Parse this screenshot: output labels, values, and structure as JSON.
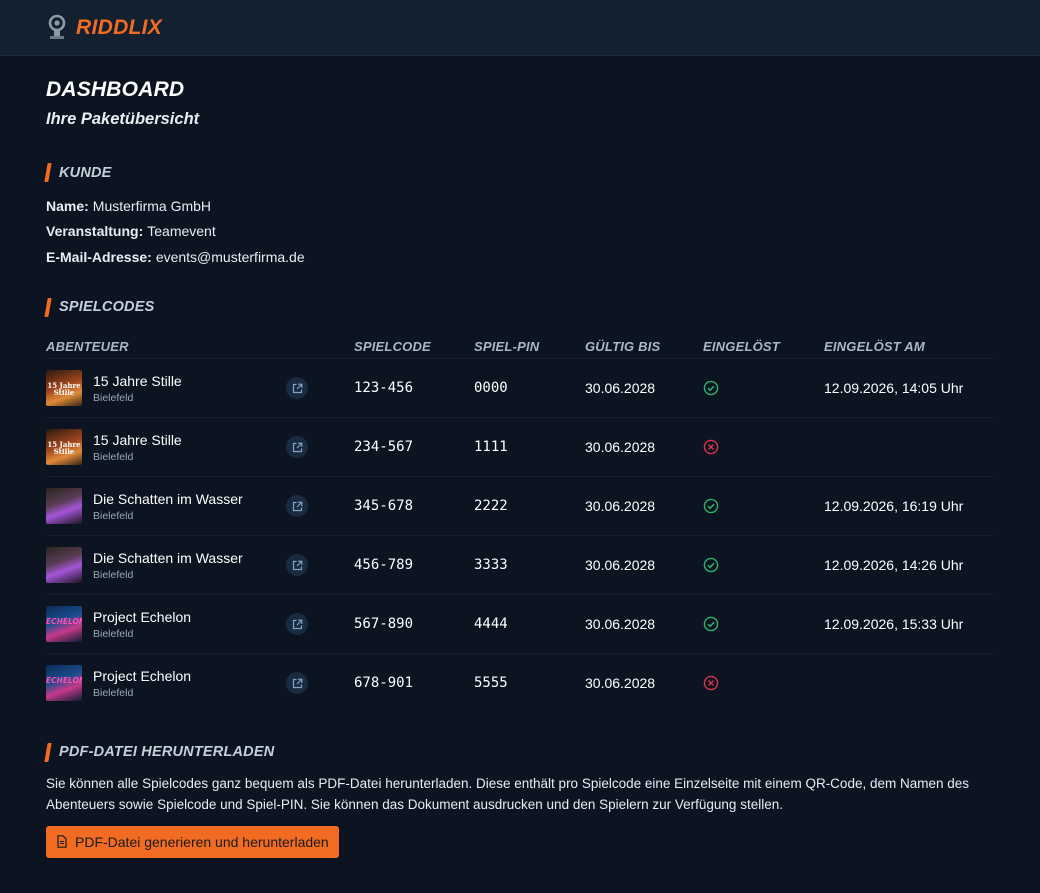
{
  "app": {
    "brand": "RIDDLIX"
  },
  "page": {
    "title": "DASHBOARD",
    "subtitle": "Ihre Paketübersicht"
  },
  "customer": {
    "heading": "KUNDE",
    "name_label": "Name:",
    "name": "Musterfirma GmbH",
    "event_label": "Veranstaltung:",
    "event": "Teamevent",
    "email_label": "E-Mail-Adresse:",
    "email": "events@musterfirma.de"
  },
  "codes": {
    "heading": "SPIELCODES",
    "columns": [
      "ABENTEUER",
      "SPIELCODE",
      "SPIEL-PIN",
      "GÜLTIG BIS",
      "EINGELÖST",
      "EINGELÖST AM"
    ],
    "rows": [
      {
        "title": "15 Jahre Stille",
        "location": "Bielefeld",
        "thumb": "15 Jahre Stille",
        "code": "123-456",
        "pin": "0000",
        "valid": "30.06.2028",
        "redeemed": true,
        "redeemed_at": "12.09.2026, 14:05 Uhr"
      },
      {
        "title": "15 Jahre Stille",
        "location": "Bielefeld",
        "thumb": "15 Jahre Stille",
        "code": "234-567",
        "pin": "1111",
        "valid": "30.06.2028",
        "redeemed": false,
        "redeemed_at": ""
      },
      {
        "title": "Die Schatten im Wasser",
        "location": "Bielefeld",
        "thumb": "",
        "code": "345-678",
        "pin": "2222",
        "valid": "30.06.2028",
        "redeemed": true,
        "redeemed_at": "12.09.2026, 16:19 Uhr"
      },
      {
        "title": "Die Schatten im Wasser",
        "location": "Bielefeld",
        "thumb": "",
        "code": "456-789",
        "pin": "3333",
        "valid": "30.06.2028",
        "redeemed": true,
        "redeemed_at": "12.09.2026, 14:26 Uhr"
      },
      {
        "title": "Project Echelon",
        "location": "Bielefeld",
        "thumb": "ECHELON",
        "code": "567-890",
        "pin": "4444",
        "valid": "30.06.2028",
        "redeemed": true,
        "redeemed_at": "12.09.2026, 15:33 Uhr"
      },
      {
        "title": "Project Echelon",
        "location": "Bielefeld",
        "thumb": "ECHELON",
        "code": "678-901",
        "pin": "5555",
        "valid": "30.06.2028",
        "redeemed": false,
        "redeemed_at": ""
      }
    ],
    "thumb_styles": [
      "t-stille",
      "t-stille",
      "t-schatten",
      "t-schatten",
      "t-echelon",
      "t-echelon"
    ]
  },
  "pdf": {
    "heading": "PDF-DATEI HERUNTERLADEN",
    "text": "Sie können alle Spielcodes ganz bequem als PDF-Datei herunterladen. Diese enthält pro Spielcode eine Einzelseite mit einem QR-Code, dem Namen des Abenteuers sowie Spielcode und Spiel-PIN. Sie können das Dokument ausdrucken und den Spielern zur Verfügung stellen.",
    "button": "PDF-Datei generieren und herunterladen"
  },
  "colors": {
    "accent": "#f26b22",
    "success": "#2fb36a",
    "error": "#d9344f",
    "background": "#0b1420"
  },
  "icons": {
    "redeemed": "check-circle-icon",
    "not_redeemed": "x-circle-icon",
    "open": "external-link-icon",
    "pdf": "document-icon"
  }
}
